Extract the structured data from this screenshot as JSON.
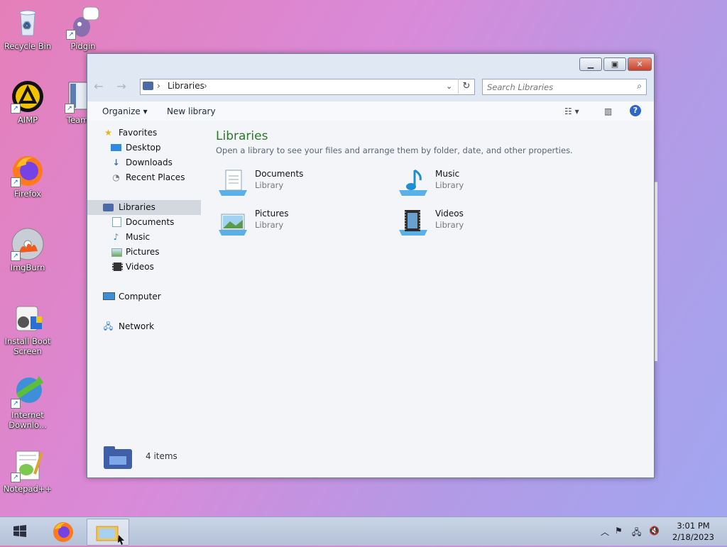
{
  "desktop": {
    "icons": [
      {
        "label": "Recycle Bin"
      },
      {
        "label": "Pidgin"
      },
      {
        "label": "AIMP"
      },
      {
        "label": "Team"
      },
      {
        "label": "Firefox"
      },
      {
        "label": "ImgBurn"
      },
      {
        "label": "Install Boot Screen"
      },
      {
        "label": "Internet Downlo..."
      },
      {
        "label": "Notepad++"
      }
    ]
  },
  "window": {
    "address": {
      "segments": [
        "Libraries"
      ]
    },
    "search": {
      "placeholder": "Search Libraries"
    },
    "toolbar": {
      "organize": "Organize",
      "new_library": "New library"
    },
    "nav": {
      "favorites": "Favorites",
      "desktop": "Desktop",
      "downloads": "Downloads",
      "recent": "Recent Places",
      "libraries": "Libraries",
      "documents": "Documents",
      "music": "Music",
      "pictures": "Pictures",
      "videos": "Videos",
      "computer": "Computer",
      "network": "Network"
    },
    "main": {
      "title": "Libraries",
      "description": "Open a library to see your files and arrange them by folder, date, and other properties.",
      "libraries": [
        {
          "name": "Documents",
          "type": "Library",
          "icon": "documents-icon"
        },
        {
          "name": "Music",
          "type": "Library",
          "icon": "music-icon"
        },
        {
          "name": "Pictures",
          "type": "Library",
          "icon": "pictures-icon"
        },
        {
          "name": "Videos",
          "type": "Library",
          "icon": "videos-icon"
        }
      ]
    },
    "status": {
      "count": "4 items"
    }
  },
  "taskbar": {
    "time": "3:01 PM",
    "date": "2/18/2023"
  }
}
